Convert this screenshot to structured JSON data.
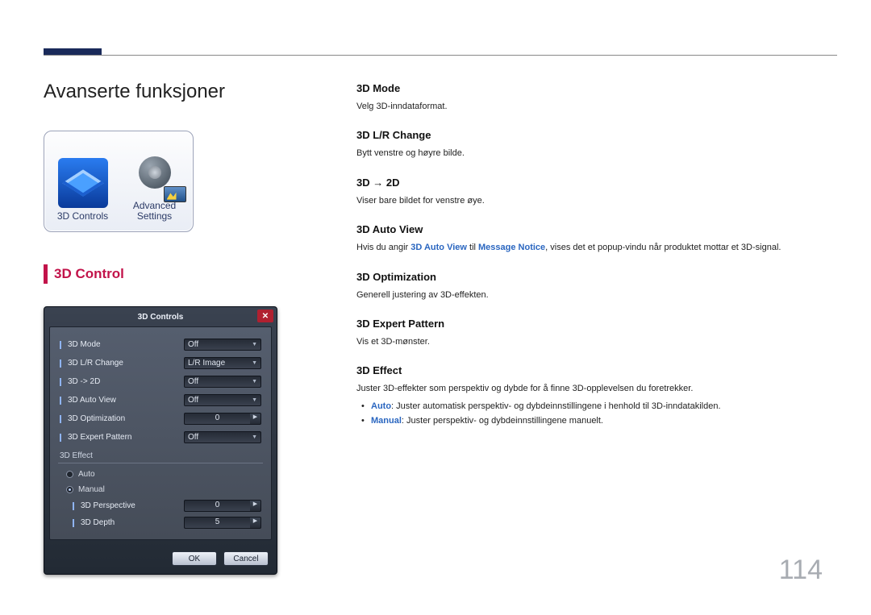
{
  "page": {
    "title": "Avanserte funksjoner",
    "number": "114"
  },
  "icon_card": {
    "tile1": "3D Controls",
    "tile2_line1": "Advanced",
    "tile2_line2": "Settings"
  },
  "section": {
    "heading": "3D Control"
  },
  "dialog": {
    "title": "3D Controls",
    "rows": [
      {
        "label": "3D Mode",
        "value": "Off",
        "type": "combo"
      },
      {
        "label": "3D L/R Change",
        "value": "L/R Image",
        "type": "combo"
      },
      {
        "label": "3D -> 2D",
        "value": "Off",
        "type": "combo"
      },
      {
        "label": "3D Auto View",
        "value": "Off",
        "type": "combo"
      },
      {
        "label": "3D Optimization",
        "value": "0",
        "type": "spin"
      },
      {
        "label": "3D Expert Pattern",
        "value": "Off",
        "type": "combo"
      }
    ],
    "group": "3D Effect",
    "radios": {
      "auto": "Auto",
      "manual": "Manual"
    },
    "subrows": [
      {
        "label": "3D Perspective",
        "value": "0"
      },
      {
        "label": "3D Depth",
        "value": "5"
      }
    ],
    "buttons": {
      "ok": "OK",
      "cancel": "Cancel"
    }
  },
  "right": {
    "mode": {
      "h": "3D Mode",
      "d": "Velg 3D-inndataformat."
    },
    "lr": {
      "h": "3D L/R Change",
      "d": "Bytt venstre og høyre bilde."
    },
    "to2d": {
      "h": "3D → 2D",
      "d": "Viser bare bildet for venstre øye."
    },
    "auto": {
      "h": "3D Auto View",
      "pre": "Hvis du angir ",
      "b1": "3D Auto View",
      "mid": " til ",
      "b2": "Message Notice",
      "post": ", vises det et popup-vindu når produktet mottar et 3D-signal."
    },
    "opt": {
      "h": "3D Optimization",
      "d": "Generell justering av 3D-effekten."
    },
    "pat": {
      "h": "3D Expert Pattern",
      "d": "Vis et 3D-mønster."
    },
    "eff": {
      "h": "3D Effect",
      "d": "Juster 3D-effekter som perspektiv og dybde for å finne 3D-opplevelsen du foretrekker.",
      "li1_b": "Auto",
      "li1_r": ": Juster automatisk perspektiv- og dybdeinnstillingene i henhold til 3D-inndatakilden.",
      "li2_b": "Manual",
      "li2_r": ": Juster perspektiv- og dybdeinnstillingene manuelt."
    }
  }
}
